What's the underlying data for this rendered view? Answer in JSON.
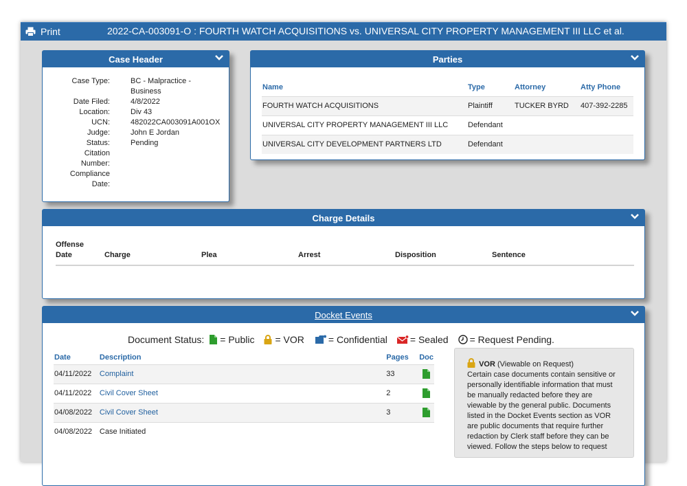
{
  "titlebar": {
    "print_label": "Print",
    "case_title": "2022-CA-003091-O : FOURTH WATCH ACQUISITIONS vs. UNIVERSAL CITY PROPERTY MANAGEMENT III LLC et al."
  },
  "case_header": {
    "title": "Case Header",
    "fields": [
      {
        "label": "Case Type:",
        "value": "BC - Malpractice - Business"
      },
      {
        "label": "Date Filed:",
        "value": "4/8/2022"
      },
      {
        "label": "Location:",
        "value": "Div 43"
      },
      {
        "label": "UCN:",
        "value": "482022CA003091A001OX"
      },
      {
        "label": "Judge:",
        "value": "John E Jordan"
      },
      {
        "label": "Status:",
        "value": "Pending"
      },
      {
        "label": "Citation Number:",
        "value": ""
      },
      {
        "label": "Compliance Date:",
        "value": ""
      }
    ]
  },
  "parties": {
    "title": "Parties",
    "columns": [
      "Name",
      "Type",
      "Attorney",
      "Atty Phone"
    ],
    "rows": [
      {
        "name": "FOURTH WATCH ACQUISITIONS",
        "type": "Plaintiff",
        "attorney": "TUCKER BYRD",
        "phone": "407-392-2285"
      },
      {
        "name": "UNIVERSAL CITY PROPERTY MANAGEMENT III LLC",
        "type": "Defendant",
        "attorney": "",
        "phone": ""
      },
      {
        "name": "UNIVERSAL CITY DEVELOPMENT PARTNERS LTD",
        "type": "Defendant",
        "attorney": "",
        "phone": ""
      }
    ]
  },
  "charge_details": {
    "title": "Charge Details",
    "columns": [
      "Offense Date",
      "Charge",
      "Plea",
      "Arrest",
      "Disposition",
      "Sentence"
    ]
  },
  "docket_events": {
    "title": "Docket Events",
    "status_legend": {
      "label": "Document Status:",
      "public": "= Public",
      "vor": "= VOR",
      "confidential": "= Confidential",
      "sealed": "= Sealed",
      "pending": "= Request Pending."
    },
    "columns": [
      "Date",
      "Description",
      "Pages",
      "Doc"
    ],
    "rows": [
      {
        "date": "04/11/2022",
        "description": "Complaint",
        "pages": "33",
        "has_doc": true,
        "link": true
      },
      {
        "date": "04/11/2022",
        "description": "Civil Cover Sheet",
        "pages": "2",
        "has_doc": true,
        "link": true
      },
      {
        "date": "04/08/2022",
        "description": "Civil Cover Sheet",
        "pages": "3",
        "has_doc": true,
        "link": true
      },
      {
        "date": "04/08/2022",
        "description": "Case Initiated",
        "pages": "",
        "has_doc": false,
        "link": false
      }
    ],
    "vor_box": {
      "heading": "VOR",
      "heading_note": "(Viewable on Request)",
      "text": "Certain case documents contain sensitive or personally identifiable information that must be manually redacted before they are viewable by the general public. Documents listed in the Docket Events section as VOR are public documents that require further redaction by Clerk staff before they can be viewed. Follow the steps below to request"
    }
  },
  "colors": {
    "header_blue": "#2b6aa8",
    "link_blue": "#1f5f9e",
    "doc_green": "#2e9d2e",
    "vor_gold": "#d9a514",
    "sealed_red": "#d92626"
  }
}
